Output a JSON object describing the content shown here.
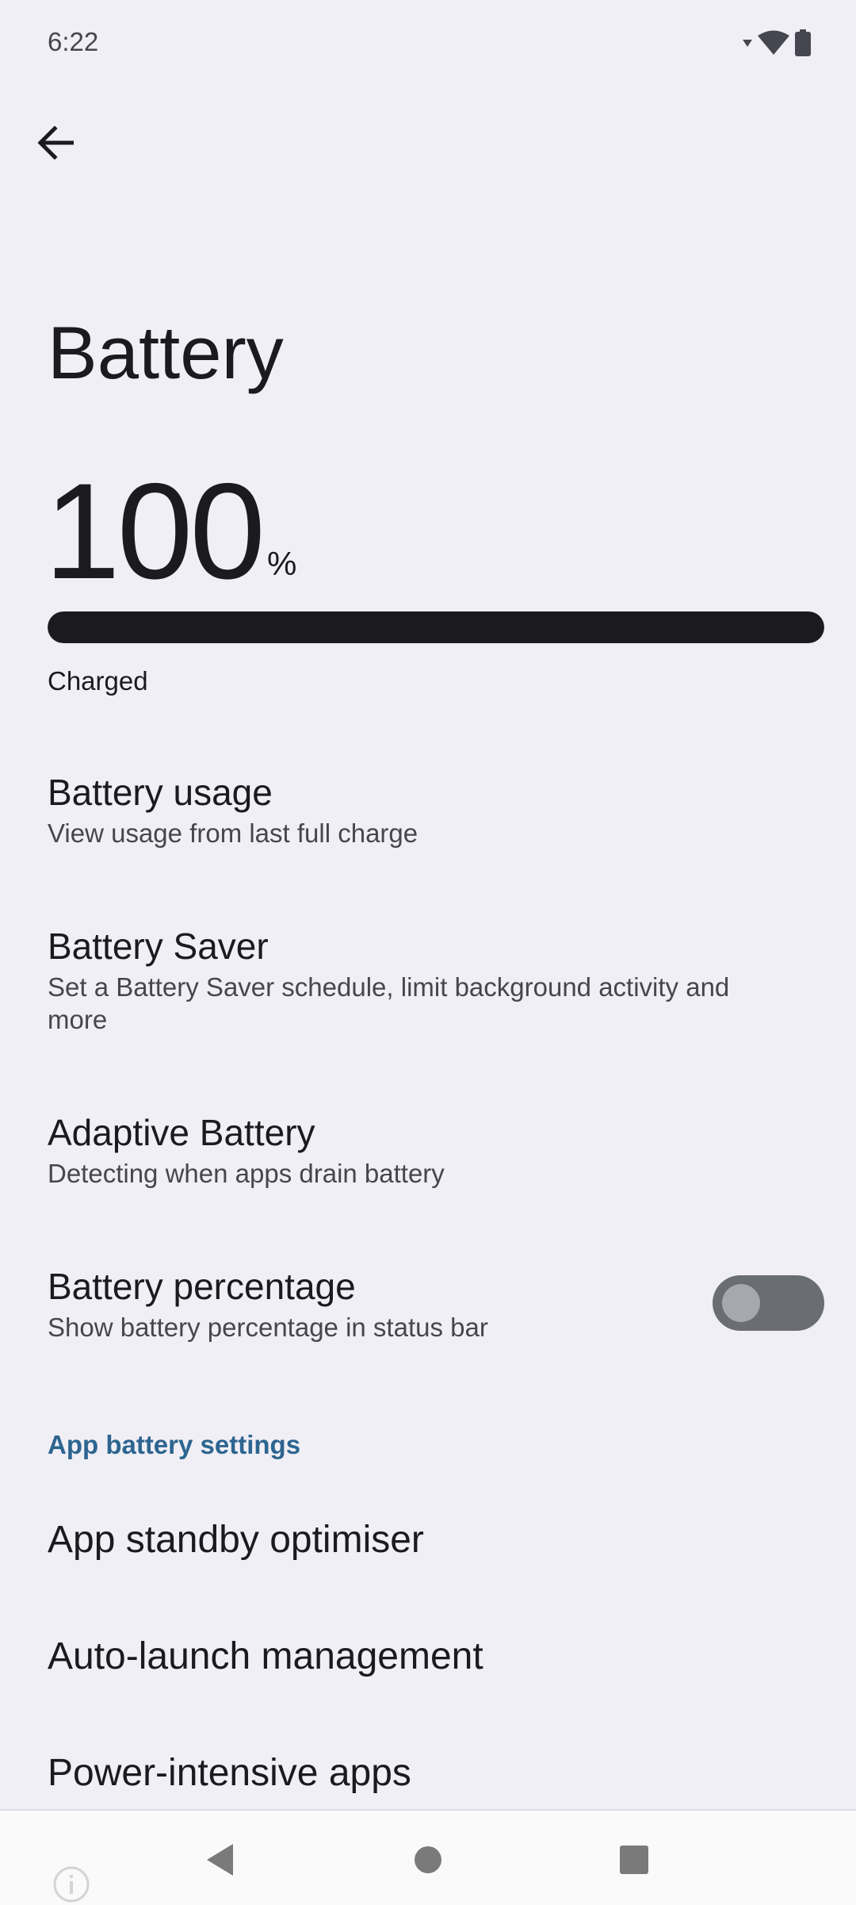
{
  "status_bar": {
    "time": "6:22",
    "icons": [
      "signal-icon",
      "wifi-icon",
      "battery-icon"
    ]
  },
  "header": {
    "back_icon": "arrow-back-icon",
    "title": "Battery"
  },
  "battery": {
    "level": "100",
    "unit": "%",
    "progress_percent": 100,
    "status": "Charged"
  },
  "preferences": [
    {
      "title": "Battery usage",
      "summary": "View usage from last full charge"
    },
    {
      "title": "Battery Saver",
      "summary": "Set a Battery Saver schedule, limit background activity and more"
    },
    {
      "title": "Adaptive Battery",
      "summary": "Detecting when apps drain battery"
    },
    {
      "title": "Battery percentage",
      "summary": "Show battery percentage in status bar",
      "toggle_on": false
    }
  ],
  "app_battery_settings": {
    "header": "App battery settings",
    "items": [
      {
        "title": "App standby optimiser"
      },
      {
        "title": "Auto-launch management"
      },
      {
        "title": "Power-intensive apps"
      }
    ]
  },
  "nav_bar": {
    "buttons": [
      "back-triangle-icon",
      "home-circle-icon",
      "recents-square-icon"
    ]
  },
  "colors": {
    "background": "#f0eff5",
    "text_primary": "#1b1b1f",
    "text_secondary": "#45464f",
    "accent": "#2d6590",
    "toggle_track": "#6b6d75"
  }
}
